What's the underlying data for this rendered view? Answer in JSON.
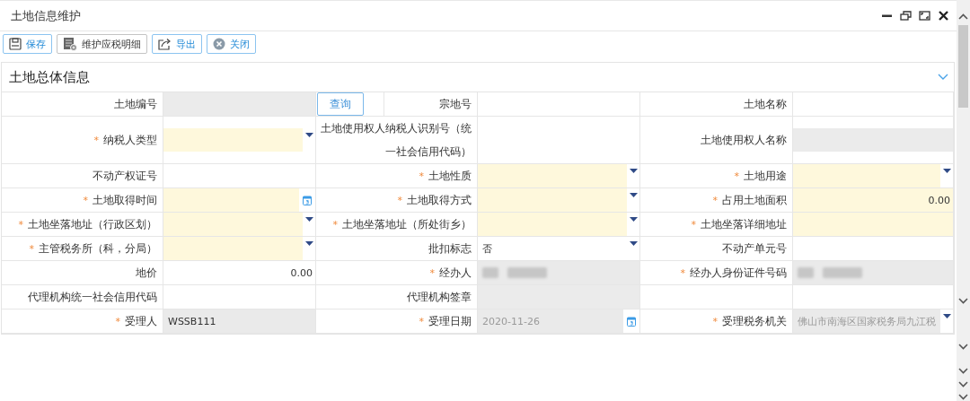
{
  "window": {
    "title": "土地信息维护"
  },
  "toolbar": [
    "保存",
    "维护应税明细",
    "导出",
    "关闭"
  ],
  "section": {
    "title": "土地总体信息",
    "expanded": true
  },
  "rows": [
    {
      "cells": [
        {
          "label": "土地编号",
          "kind": "text",
          "required": false,
          "readonly": true,
          "action": "查询"
        },
        {
          "label": "宗地号",
          "kind": "text",
          "required": false,
          "readonly": false
        },
        {
          "label": "土地名称",
          "kind": "text",
          "required": false,
          "readonly": false
        }
      ]
    },
    {
      "cells": [
        {
          "mark": "*",
          "label": "纳税人类型",
          "kind": "select",
          "required": true,
          "readonly": false
        },
        {
          "label": "土地使用权人纳税人识别号（统一社会信用代码）",
          "kind": "text",
          "required": false,
          "readonly": false
        },
        {
          "label": "土地使用权人名称",
          "kind": "text",
          "required": false,
          "readonly": true
        }
      ]
    },
    {
      "cells": [
        {
          "label": "不动产权证号",
          "kind": "text",
          "required": false,
          "readonly": false
        },
        {
          "mark": "*",
          "label": "土地性质",
          "kind": "select",
          "required": true,
          "readonly": false
        },
        {
          "mark": "*",
          "label": "土地用途",
          "kind": "select",
          "required": true,
          "readonly": false
        }
      ]
    },
    {
      "cells": [
        {
          "mark": "*",
          "label": "土地取得时间",
          "kind": "date",
          "required": true,
          "readonly": false
        },
        {
          "mark": "*",
          "label": "土地取得方式",
          "kind": "select",
          "required": true,
          "readonly": false
        },
        {
          "mark": "*",
          "label": "占用土地面积",
          "kind": "number",
          "required": true,
          "readonly": false,
          "disabled": false,
          "value": "0.00"
        }
      ]
    },
    {
      "cells": [
        {
          "mark": "*",
          "label": "土地坐落地址（行政区划）",
          "kind": "select",
          "required": true,
          "readonly": false
        },
        {
          "mark": "*",
          "label": "土地坐落地址（所处街乡）",
          "kind": "select",
          "required": true,
          "readonly": false
        },
        {
          "mark": "*",
          "label": "土地坐落详细地址",
          "kind": "text",
          "required": true,
          "readonly": false
        }
      ]
    },
    {
      "cells": [
        {
          "mark": "*",
          "label": "主管税务所（科，分局）",
          "kind": "select",
          "required": true,
          "readonly": false
        },
        {
          "label": "批扣标志",
          "kind": "select",
          "required": false,
          "readonly": false,
          "disabled": false,
          "value": "否"
        },
        {
          "label": "不动产单元号",
          "kind": "text",
          "required": false,
          "readonly": false
        }
      ]
    },
    {
      "cells": [
        {
          "label": "地价",
          "kind": "number",
          "required": false,
          "readonly": false,
          "disabled": false,
          "value": "0.00"
        },
        {
          "mark": "*",
          "label": "经办人",
          "kind": "masked",
          "required": true,
          "readonly": true
        },
        {
          "mark": "*",
          "label": "经办人身份证件号码",
          "kind": "masked",
          "required": true,
          "readonly": true
        }
      ]
    },
    {
      "cells": [
        {
          "label": "代理机构统一社会信用代码",
          "kind": "text",
          "required": false,
          "readonly": false
        },
        {
          "label": "代理机构签章",
          "kind": "text",
          "required": false,
          "readonly": true
        }
      ]
    },
    {
      "cells": [
        {
          "mark": "*",
          "label": "受理人",
          "kind": "text",
          "required": true,
          "readonly": true,
          "disabled": false,
          "value": "WSSB111"
        },
        {
          "mark": "*",
          "label": "受理日期",
          "kind": "date",
          "required": true,
          "readonly": true,
          "disabled": true,
          "value": "2020-11-26"
        },
        {
          "mark": "*",
          "label": "受理税务机关",
          "kind": "select",
          "required": true,
          "readonly": true,
          "disabled": true,
          "value": "佛山市南海区国家税务局九江税"
        }
      ]
    }
  ]
}
